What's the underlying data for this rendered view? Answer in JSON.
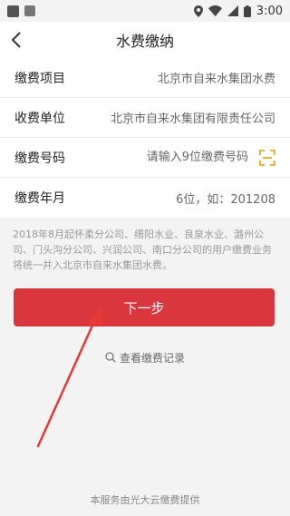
{
  "status_bar": {
    "time": "3:00"
  },
  "nav": {
    "title": "水费缴纳"
  },
  "form": {
    "rows": [
      {
        "label": "缴费项目",
        "value": "北京市自来水集团水费"
      },
      {
        "label": "收费单位",
        "value": "北京市自来水集团有限责任公司"
      },
      {
        "label": "缴费号码",
        "placeholder": "请输入9位缴费号码"
      },
      {
        "label": "缴费年月",
        "value": "6位，如：201208"
      }
    ]
  },
  "notice": "2018年8月起怀柔分公司、缙阳水业、良泉水业、潞州公司、门头沟分公司、兴润公司、南口分公司的用户缴费业务将统一并入北京市自来水集团水费。",
  "actions": {
    "next_label": "下一步",
    "history_label": "查看缴费记录"
  },
  "footer": "本服务由光大云缴费提供",
  "colors": {
    "primary": "#d9363e",
    "annotation_arrow": "#e53935"
  }
}
